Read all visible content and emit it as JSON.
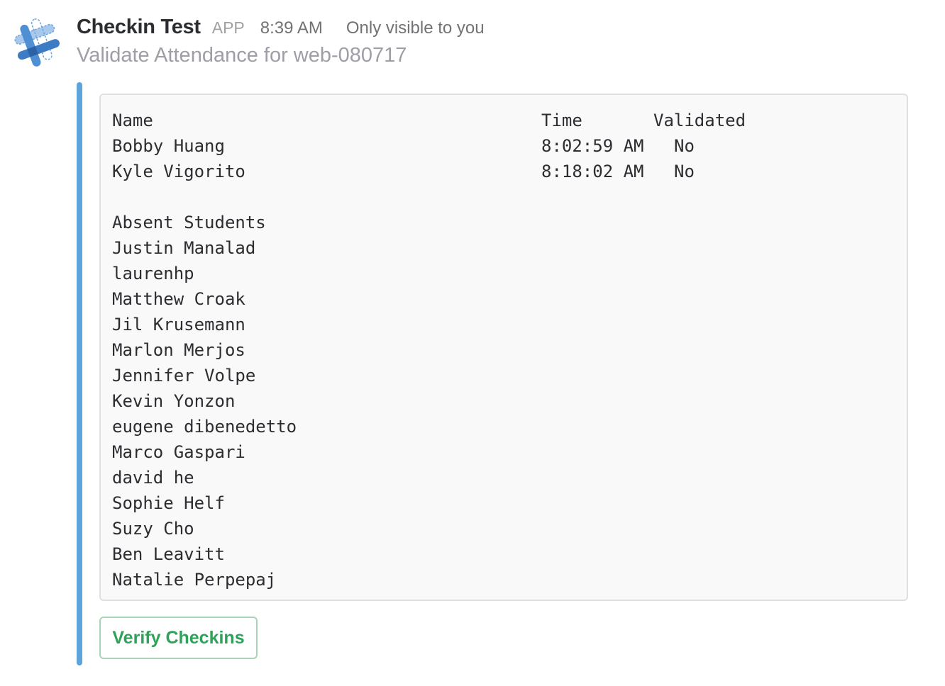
{
  "message": {
    "sender": "Checkin Test",
    "app_badge": "APP",
    "timestamp": "8:39 AM",
    "visibility": "Only visible to you",
    "subtitle": "Validate Attendance for web-080717"
  },
  "attendance": {
    "headers": {
      "name": "Name",
      "time": "Time",
      "validated": "Validated"
    },
    "checked_in": [
      {
        "name": "Bobby Huang",
        "time": "8:02:59 AM",
        "validated": "No"
      },
      {
        "name": "Kyle Vigorito",
        "time": "8:18:02 AM",
        "validated": "No"
      }
    ],
    "absent_header": "Absent Students",
    "absent": [
      "Justin Manalad",
      "laurenhp",
      "Matthew Croak",
      "Jil Krusemann",
      "Marlon Merjos",
      "Jennifer Volpe",
      "Kevin Yonzon",
      "eugene dibenedetto",
      "Marco Gaspari",
      "david he",
      "Sophie Helf",
      "Suzy Cho",
      "Ben Leavitt",
      "Natalie Perpepaj"
    ]
  },
  "actions": {
    "verify_label": "Verify Checkins"
  },
  "colors": {
    "attachment_bar": "#5ea4db",
    "button_text": "#2fa25a",
    "button_border": "#a8d4b7"
  },
  "icons": {
    "avatar": "checkin-app-logo-icon"
  }
}
